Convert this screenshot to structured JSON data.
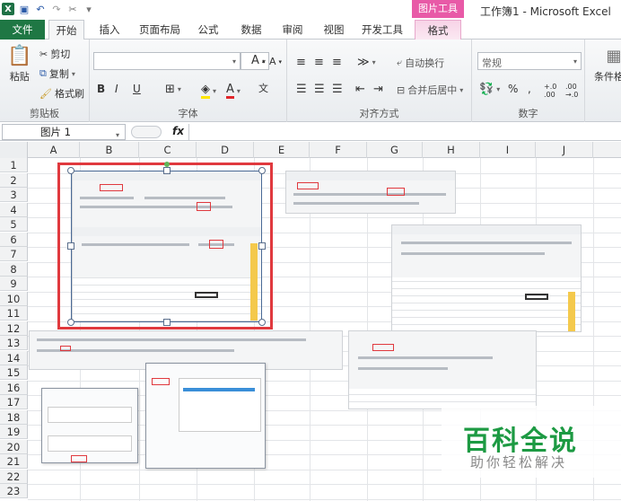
{
  "window": {
    "title": "工作簿1 - Microsoft Excel",
    "context_tab_header": "图片工具"
  },
  "quick_access": {
    "icons": [
      "excel-logo-icon",
      "save-icon",
      "undo-icon",
      "redo-icon",
      "customize-icon"
    ]
  },
  "tabs": [
    {
      "label": "文件"
    },
    {
      "label": "开始"
    },
    {
      "label": "插入"
    },
    {
      "label": "页面布局"
    },
    {
      "label": "公式"
    },
    {
      "label": "数据"
    },
    {
      "label": "审阅"
    },
    {
      "label": "视图"
    },
    {
      "label": "开发工具"
    },
    {
      "label": "格式"
    }
  ],
  "ribbon": {
    "clipboard": {
      "label": "剪贴板",
      "paste": "粘贴",
      "cut": "剪切",
      "copy": "复制",
      "format_painter": "格式刷"
    },
    "font": {
      "label": "字体",
      "bold": "B",
      "italic": "I",
      "underline": "U",
      "grow": "A",
      "shrink": "A",
      "color": "A"
    },
    "alignment": {
      "label": "对齐方式",
      "wrap": "自动换行",
      "merge": "合并后居中"
    },
    "number": {
      "label": "数字",
      "format_value": "常规",
      "percent": "%",
      "comma": ",",
      "inc_decimal": "+.0 .00",
      "dec_decimal": ".00 →.0"
    },
    "styles": {
      "conditional": "条件格式"
    }
  },
  "formula_bar": {
    "name_box": "图片 1",
    "fx": "fx"
  },
  "sheet": {
    "columns": [
      "A",
      "B",
      "C",
      "D",
      "E",
      "F",
      "G",
      "H",
      "I",
      "J"
    ],
    "rows": [
      "1",
      "2",
      "3",
      "4",
      "5",
      "6",
      "7",
      "8",
      "9",
      "10",
      "11",
      "12",
      "13",
      "14",
      "15",
      "16",
      "17",
      "18",
      "19",
      "20",
      "21",
      "22",
      "23"
    ]
  },
  "watermark": {
    "main": "百科全说",
    "sub": "助你轻松解决"
  },
  "colors": {
    "file_tab": "#1f7744",
    "context_tab": "#e85aa7",
    "selection_frame": "#e0393e",
    "watermark": "#1d9a43"
  }
}
